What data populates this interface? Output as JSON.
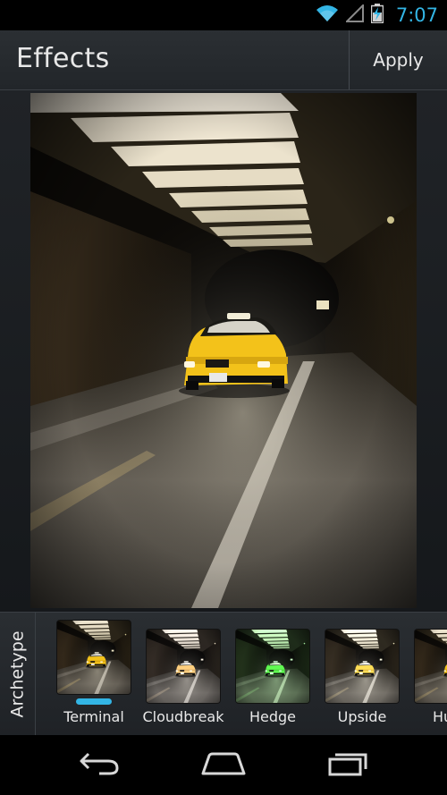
{
  "status_bar": {
    "time": "7:07",
    "icons": [
      "wifi-icon",
      "signal-icon",
      "battery-charging-icon"
    ],
    "accent_color": "#33b5e5"
  },
  "action_bar": {
    "title": "Effects",
    "apply_label": "Apply"
  },
  "photo": {
    "subject": "taxi-in-tunnel"
  },
  "filters": {
    "category": "Archetype",
    "selected": "Terminal",
    "items": [
      {
        "label": "Terminal",
        "tint": "warm"
      },
      {
        "label": "Cloudbreak",
        "tint": "cool"
      },
      {
        "label": "Hedge",
        "tint": "green"
      },
      {
        "label": "Upside",
        "tint": "neutral"
      },
      {
        "label": "Hu",
        "tint": "neutral"
      }
    ]
  },
  "nav_bar": {
    "icons": [
      "back-icon",
      "home-icon",
      "recent-apps-icon"
    ]
  }
}
